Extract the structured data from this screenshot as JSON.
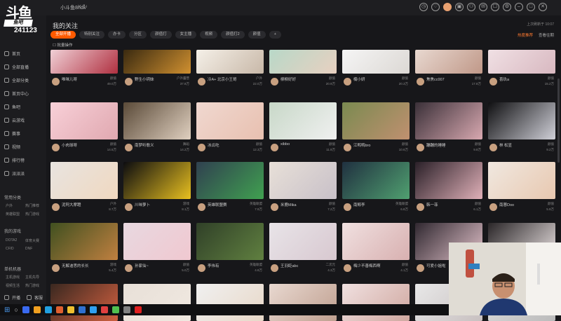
{
  "logo": {
    "brand": "斗鱼",
    "sub": "鱼吧",
    "room": "241123"
  },
  "titlebar": {
    "title": "小斗鱼8ndk",
    "tab_close": "✕",
    "tab_refresh": "↻"
  },
  "header": {
    "heading": "我的关注",
    "update_note": "上次刷新于 10:07",
    "batch": "批量操作"
  },
  "right_actions": {
    "a": "热度推荐",
    "b": "查看往期"
  },
  "filters": [
    "全部开播",
    "特别关注",
    "办卡",
    "分区",
    "颜值打",
    "女主播",
    "视频",
    "颜值打2",
    "颜值"
  ],
  "sidebar": {
    "items": [
      "首页",
      "全部直播",
      "全部分类",
      "首页中心",
      "鱼吧",
      "云游戏",
      "赛事",
      "视频",
      "排行榜",
      "派派派"
    ],
    "sections": [
      "常用分类",
      "我的游戏",
      "单机机器"
    ],
    "sub": [
      "户外",
      "热门推荐",
      "英雄联盟",
      "热门游戏",
      "DOTA2",
      "体育大赛",
      "CF/D",
      "DNF",
      "主机游戏",
      "主机先导",
      "视频生活",
      "热门游戏"
    ],
    "footer_a": "开播",
    "footer_b": "客服"
  },
  "cards": [
    {
      "name": "唯咪儿呀",
      "sub": "",
      "cat": "颜值",
      "num": "49.0万",
      "c1": "#f0d0d6",
      "c2": "#b03040"
    },
    {
      "name": "野生小玥妹",
      "sub": "",
      "cat": "户外露营",
      "num": "37.8万",
      "c1": "#3a2a10",
      "c2": "#d09030"
    },
    {
      "name": "冷A+ 北京小王哥",
      "sub": "",
      "cat": "户外",
      "num": "22.0万",
      "c1": "#f5f0e8",
      "c2": "#c8b8a8"
    },
    {
      "name": "柳柳好好",
      "sub": "",
      "cat": "颜值",
      "num": "20.9万",
      "c1": "#b8d8c8",
      "c2": "#e8d0c0"
    },
    {
      "name": "楠小妍",
      "sub": "",
      "cat": "颜值",
      "num": "20.3万",
      "c1": "#f5f5f5",
      "c2": "#dcd8d4"
    },
    {
      "name": "焦焦cc007",
      "sub": "",
      "cat": "颜值",
      "num": "17.8万",
      "c1": "#e8d8d0",
      "c2": "#c09888"
    },
    {
      "name": "喜玖a",
      "sub": "",
      "cat": "颜值",
      "num": "15.2万",
      "c1": "#f0e0e4",
      "c2": "#d8b8c0"
    },
    {
      "name": "小肉球呀",
      "sub": "",
      "cat": "颜值",
      "num": "14.5万",
      "c1": "#f8d0d8",
      "c2": "#e0a8b0"
    },
    {
      "name": "南梦听歌义",
      "sub": "",
      "cat": "舞蹈",
      "num": "14.2万",
      "c1": "#5a4a38",
      "c2": "#e0d0c0"
    },
    {
      "name": "冰瓜吃",
      "sub": "",
      "cat": "颜值",
      "num": "12.3万",
      "c1": "#f0d8d0",
      "c2": "#e8c0b0"
    },
    {
      "name": "xibbo",
      "sub": "",
      "cat": "颜值",
      "num": "11.9万",
      "c1": "#c8d8c8",
      "c2": "#f0f0f0"
    },
    {
      "name": "江鸭鸭bro",
      "sub": "",
      "cat": "颜值",
      "num": "10.6万",
      "c1": "#7a8a50",
      "c2": "#c09070"
    },
    {
      "name": "蹦蹦的睡睡",
      "sub": "",
      "cat": "颜值",
      "num": "9.8万",
      "c1": "#3a3038",
      "c2": "#d8a8b0"
    },
    {
      "name": "林 松显",
      "sub": "",
      "cat": "颜值",
      "num": "9.2万",
      "c1": "#101012",
      "c2": "#d0d0d8"
    },
    {
      "name": "泥阿大摩蹬",
      "sub": "",
      "cat": "户外",
      "num": "8.7万",
      "c1": "#e8e4e0",
      "c2": "#f0d8c0"
    },
    {
      "name": "川味萝卜",
      "sub": "",
      "cat": "游戏",
      "num": "8.1万",
      "c1": "#0c0c10",
      "c2": "#e8c020"
    },
    {
      "name": "英雄联盟赛",
      "sub": "",
      "cat": "英雄联盟",
      "num": "7.9万",
      "c1": "#304050",
      "c2": "#40a050"
    },
    {
      "name": "米鹿Mika",
      "sub": "",
      "cat": "颜值",
      "num": "7.2万",
      "c1": "#e8e0d8",
      "c2": "#c8c0c8"
    },
    {
      "name": "南鲸李",
      "sub": "",
      "cat": "英雄联盟",
      "num": "6.8万",
      "c1": "#203040",
      "c2": "#50a070"
    },
    {
      "name": "韩一菲",
      "sub": "",
      "cat": "颜值",
      "num": "6.1万",
      "c1": "#2a2028",
      "c2": "#e0b0b8"
    },
    {
      "name": "南蓉Doo",
      "sub": "",
      "cat": "颜值",
      "num": "5.9万",
      "c1": "#f0e8e0",
      "c2": "#e8c8b0"
    },
    {
      "name": "无解迪思的长长",
      "sub": "",
      "cat": "游戏",
      "num": "5.4万",
      "c1": "#405020",
      "c2": "#c08040"
    },
    {
      "name": "孙家仙~",
      "sub": "",
      "cat": "颜值",
      "num": "5.0万",
      "c1": "#e8d8e0",
      "c2": "#f0c8d0"
    },
    {
      "name": "李伟有",
      "sub": "",
      "cat": "英雄联盟",
      "num": "4.8万",
      "c1": "#304028",
      "c2": "#608040"
    },
    {
      "name": "王羽眨abc",
      "sub": "",
      "cat": "二次元",
      "num": "4.3万",
      "c1": "#e8e4e8",
      "c2": "#d8c8d0"
    },
    {
      "name": "梅少不善梅西啊",
      "sub": "",
      "cat": "颜值",
      "num": "4.1万",
      "c1": "#f0e0e0",
      "c2": "#d8b0b0"
    },
    {
      "name": "可爱小姐啦",
      "sub": "",
      "cat": "颜值",
      "num": "3.8万",
      "c1": "#302830",
      "c2": "#e0c0c8"
    },
    {
      "name": "",
      "sub": "",
      "cat": "",
      "num": "",
      "c1": "#2a2628",
      "c2": "#e8e0e0"
    },
    {
      "name": "",
      "sub": "",
      "cat": "",
      "num": "",
      "c1": "#3a2820",
      "c2": "#d06040"
    },
    {
      "name": "",
      "sub": "",
      "cat": "",
      "num": "",
      "c1": "#e8e0d8",
      "c2": "#f0e8e0"
    },
    {
      "name": "",
      "sub": "",
      "cat": "",
      "num": "",
      "c1": "#f0f0f0",
      "c2": "#e8d8c8"
    },
    {
      "name": "",
      "sub": "",
      "cat": "",
      "num": "",
      "c1": "#e8d8d0",
      "c2": "#c0a090"
    },
    {
      "name": "",
      "sub": "",
      "cat": "",
      "num": "",
      "c1": "#f0e0e0",
      "c2": "#d0a8a0"
    },
    {
      "name": "",
      "sub": "",
      "cat": "",
      "num": "",
      "c1": "#e8e8e8",
      "c2": "#c8c0c0"
    },
    {
      "name": "",
      "sub": "",
      "cat": "",
      "num": "",
      "c1": "#ddd",
      "c2": "#bbb"
    }
  ],
  "colors": {
    "accent": "#ff5a00",
    "bg": "#17171a",
    "sidebar": "#1c1c1f"
  },
  "taskbar_icons": [
    "#3a6af0",
    "#f0a020",
    "#20a0e0",
    "#e06030",
    "#f0c030",
    "#3070d0",
    "#30a0f0",
    "#e04040",
    "#50c050",
    "#808080",
    "#e02020"
  ]
}
